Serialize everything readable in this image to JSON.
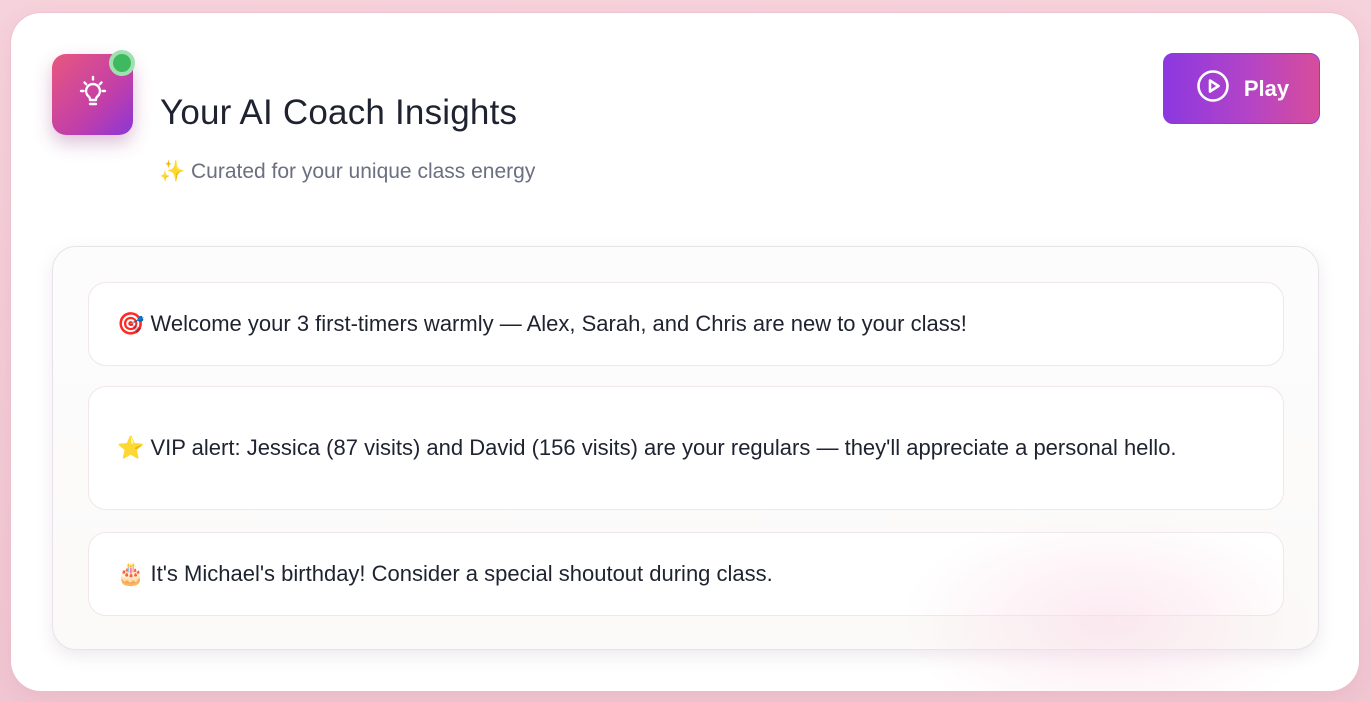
{
  "header": {
    "title": "Your AI Coach Insights",
    "subtitle": "✨ Curated for your unique class energy",
    "icon": "lightbulb-icon",
    "status_color": "#3fb95f"
  },
  "play_button": {
    "label": "Play",
    "icon": "play-circle-icon"
  },
  "insights": [
    {
      "text": "🎯 Welcome your 3 first-timers warmly — Alex, Sarah, and Chris are new to your class!"
    },
    {
      "text": "⭐ VIP alert: Jessica (87 visits) and David (156 visits) are your regulars — they'll appreciate a personal hello."
    },
    {
      "text": "🎂 It's Michael's birthday! Consider a special shoutout during class."
    }
  ],
  "colors": {
    "accent_start": "#8c38e0",
    "accent_end": "#d74d9b",
    "icon_gradient_start": "#e8577f",
    "icon_gradient_end": "#8b36d6"
  }
}
